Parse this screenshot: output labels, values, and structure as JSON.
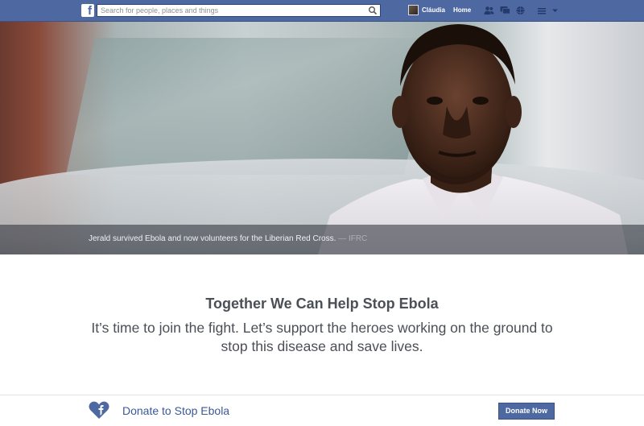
{
  "topbar": {
    "logo": "f",
    "search_placeholder": "Search for people, places and things",
    "user_name": "Cláudia",
    "home_label": "Home",
    "icons": [
      "friends-icon",
      "messages-icon",
      "notifications-icon",
      "privacy-icon",
      "settings-icon"
    ]
  },
  "hero": {
    "caption": "Jerald survived Ebola and now volunteers for the Liberian Red Cross.",
    "credit": " — IFRC"
  },
  "main": {
    "headline": "Together We Can Help Stop Ebola",
    "subtext": "It’s time to join the fight. Let’s support the heroes working on the ground to stop this disease and save lives."
  },
  "donate": {
    "label": "Donate to Stop Ebola",
    "button": "Donate Now"
  },
  "colors": {
    "brand": "#4e69a2",
    "link": "#3b5998",
    "text": "#4b4f56"
  }
}
